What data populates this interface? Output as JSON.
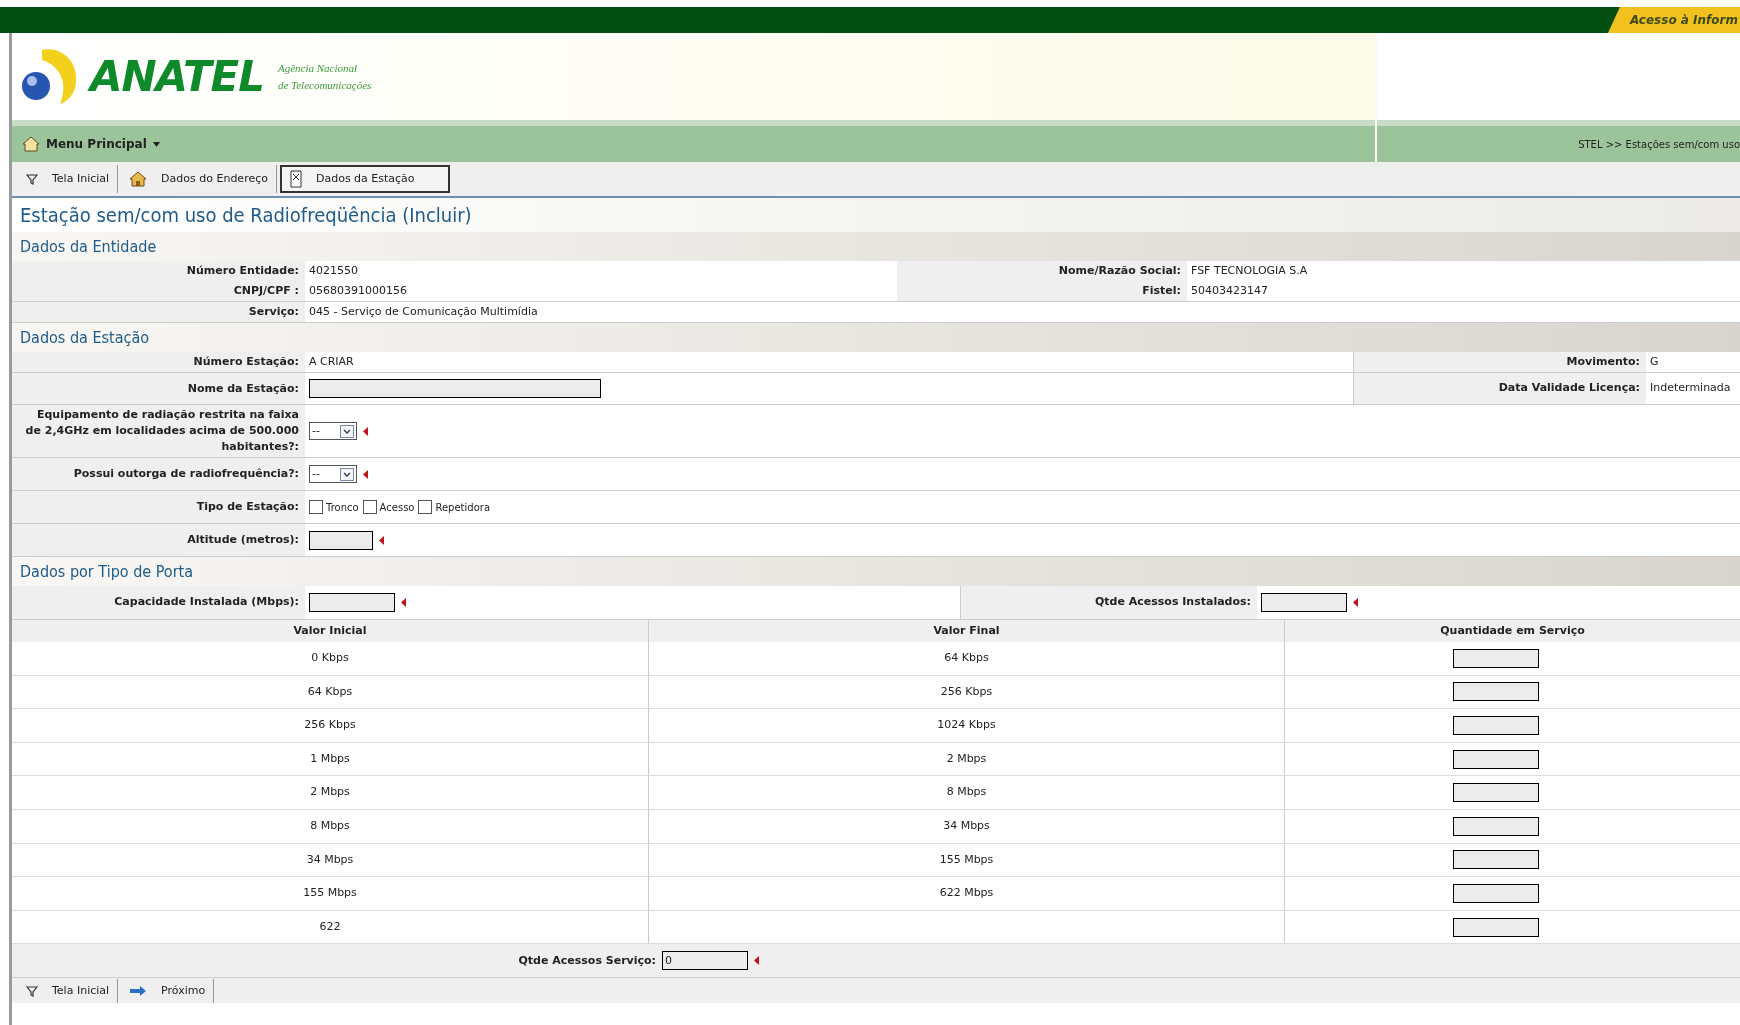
{
  "top_bar": {
    "link": "Acesso à Inform"
  },
  "header": {
    "logo_text": "ANATEL",
    "agency_line_1": "Agência Nacional",
    "agency_line_2": "de Telecomunicações"
  },
  "menu": {
    "label": "Menu Principal",
    "breadcrumb": "STEL >> Estações sem/com uso"
  },
  "tabs": [
    {
      "label": "Tela Inicial",
      "kind": "filter",
      "selected": false
    },
    {
      "label": "Dados do Endereço",
      "kind": "home",
      "selected": false
    },
    {
      "label": "Dados da Estação",
      "kind": "doc",
      "selected": true
    }
  ],
  "page_title": "Estação sem/com uso de Radiofreqüência (Incluir)",
  "entity": {
    "heading": "Dados da Entidade",
    "left": [
      {
        "label": "Número Entidade:",
        "value": "4021550"
      },
      {
        "label": "CNPJ/CPF :",
        "value": "05680391000156"
      }
    ],
    "right": [
      {
        "label": "Nome/Razão Social:",
        "value": "FSF TECNOLOGIA S.A"
      },
      {
        "label": "Fistel:",
        "value": "50403423147"
      }
    ],
    "service": {
      "label": "Serviço:",
      "value": "045 - Serviço de Comunicação Multimídia"
    }
  },
  "station": {
    "heading": "Dados da Estação",
    "rows": [
      {
        "kind": "text",
        "label": "Número Estação:",
        "value": "A CRIAR",
        "right": {
          "label": "Movimento:",
          "value": "G"
        }
      },
      {
        "kind": "input",
        "label": "Nome da Estação:",
        "right": {
          "label": "Data Validade Licença:",
          "value": "Indeterminada"
        }
      },
      {
        "kind": "select",
        "label": "Equipamento de radiação restrita na faixa de 2,4GHz em localidades acima de 500.000 habitantes?:",
        "value": "--",
        "required": true
      },
      {
        "kind": "select",
        "label": "Possui outorga de radiofrequência?:",
        "value": "--",
        "required": true
      },
      {
        "kind": "checkboxes",
        "label": "Tipo de Estação:",
        "options": [
          {
            "label": "Tronco",
            "checked": false
          },
          {
            "label": "Acesso",
            "checked": false
          },
          {
            "label": "Repetidora",
            "checked": false
          }
        ]
      },
      {
        "kind": "input",
        "label": "Altitude (metros):",
        "required": true
      }
    ]
  },
  "ports": {
    "heading": "Dados por Tipo de Porta",
    "capacity": {
      "label": "Capacidade Instalada (Mbps):",
      "required": true
    },
    "installed": {
      "label": "Qtde Acessos Instalados:",
      "required": true
    },
    "table": {
      "columns": [
        "Valor Inicial",
        "Valor Final",
        "Quantidade em Serviço"
      ],
      "rows": [
        {
          "initial": "0 Kbps",
          "final": "64 Kbps"
        },
        {
          "initial": "64 Kbps",
          "final": "256 Kbps"
        },
        {
          "initial": "256 Kbps",
          "final": "1024 Kbps"
        },
        {
          "initial": "1 Mbps",
          "final": "2 Mbps"
        },
        {
          "initial": "2 Mbps",
          "final": "8 Mbps"
        },
        {
          "initial": "8 Mbps",
          "final": "34 Mbps"
        },
        {
          "initial": "34 Mbps",
          "final": "155 Mbps"
        },
        {
          "initial": "155 Mbps",
          "final": "622 Mbps"
        },
        {
          "initial": "622"
        }
      ]
    },
    "service_count": {
      "label": "Qtde Acessos Serviço:",
      "value": "0",
      "required": true
    }
  },
  "footer": [
    {
      "label": "Tela Inicial",
      "kind": "filter"
    },
    {
      "label": "Próximo",
      "kind": "arrow"
    }
  ]
}
